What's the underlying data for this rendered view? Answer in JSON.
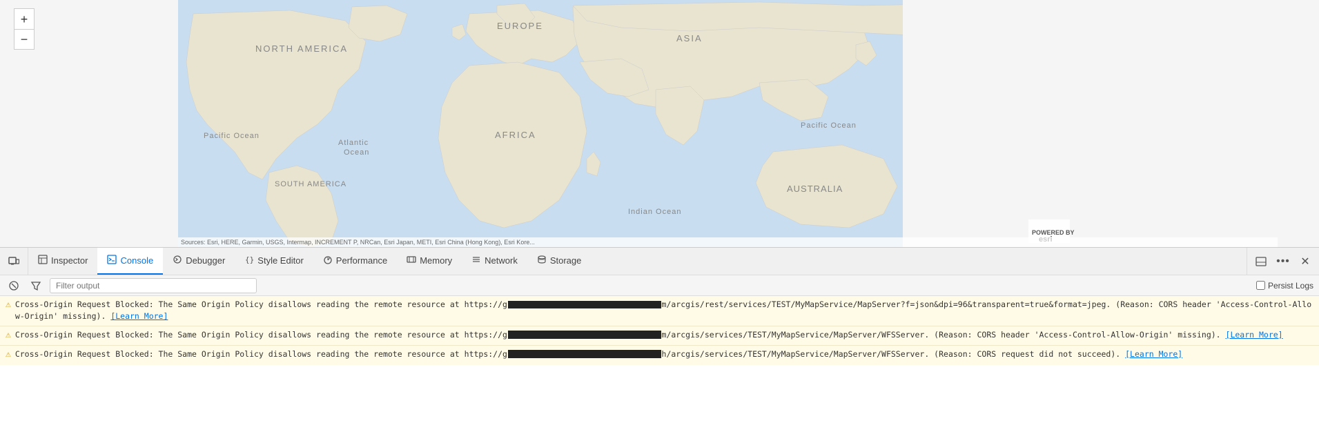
{
  "map": {
    "attribution": "Sources: Esri, HERE, Garmin, USGS, Intermap, INCREMENT P, NRCan, Esri Japan, METI, Esri China (Hong Kong), Esri Kore...",
    "zoom_in": "+",
    "zoom_out": "−",
    "esri_logo": "esri"
  },
  "devtools": {
    "tabs": [
      {
        "id": "inspector",
        "label": "Inspector",
        "icon": "⬜",
        "active": false
      },
      {
        "id": "console",
        "label": "Console",
        "icon": "▤",
        "active": true
      },
      {
        "id": "debugger",
        "label": "Debugger",
        "icon": "◯",
        "active": false
      },
      {
        "id": "style-editor",
        "label": "Style Editor",
        "icon": "{}",
        "active": false
      },
      {
        "id": "performance",
        "label": "Performance",
        "icon": "⏱",
        "active": false
      },
      {
        "id": "memory",
        "label": "Memory",
        "icon": "◫",
        "active": false
      },
      {
        "id": "network",
        "label": "Network",
        "icon": "≡",
        "active": false
      },
      {
        "id": "storage",
        "label": "Storage",
        "icon": "🗄",
        "active": false
      }
    ],
    "toolbar_right": {
      "responsive_icon": "▭",
      "more_icon": "•••",
      "close_icon": "✕"
    }
  },
  "console": {
    "filter_placeholder": "Filter output",
    "persist_logs_label": "Persist Logs",
    "messages": [
      {
        "type": "warn",
        "text_before": "Cross-Origin Request Blocked: The Same Origin Policy disallows reading the remote resource at https://g",
        "redacted": true,
        "text_after": "m/arcgis/rest/services/TEST/MyMapService/MapServer?f=json&dpi=96&transparent=true&format=jpeg. (Reason: CORS header 'Access-Control-Allow-Origin' missing).",
        "link": "[Learn More]"
      },
      {
        "type": "warn",
        "text_before": "Cross-Origin Request Blocked: The Same Origin Policy disallows reading the remote resource at https://g",
        "redacted": true,
        "text_after": "m/arcgis/services/TEST/MyMapService/MapServer/WFSServer. (Reason: CORS header 'Access-Control-Allow-Origin' missing).",
        "link": "[Learn More]"
      },
      {
        "type": "warn",
        "text_before": "Cross-Origin Request Blocked: The Same Origin Policy disallows reading the remote resource at https://g",
        "redacted": true,
        "text_after": "h/arcgis/services/TEST/MyMapService/MapServer/WFSServer. (Reason: CORS request did not succeed).",
        "link": "[Learn More]"
      }
    ]
  }
}
